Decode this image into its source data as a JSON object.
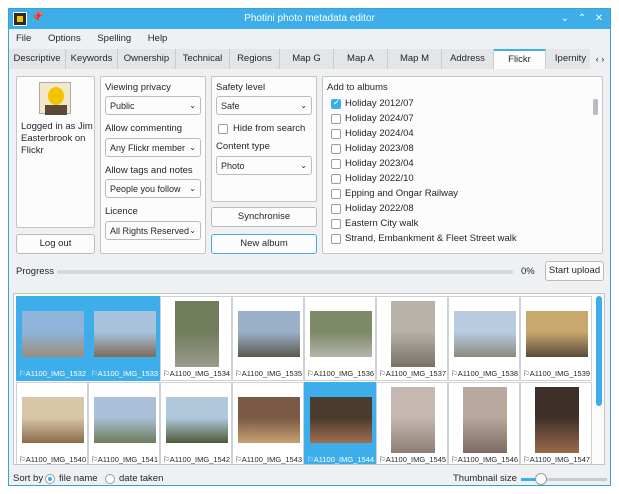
{
  "window": {
    "title": "Photini photo metadata editor"
  },
  "menu": [
    "File",
    "Options",
    "Spelling",
    "Help"
  ],
  "tabs": [
    "Descriptive",
    "Keywords",
    "Ownership",
    "Technical",
    "Regions",
    "Map G",
    "Map A",
    "Map M",
    "Address",
    "Flickr",
    "Ipernity"
  ],
  "active_tab": "Flickr",
  "user": {
    "logged_in_text": "Logged in as Jim Easterbrook on Flickr",
    "logout_label": "Log out"
  },
  "privacy": {
    "viewing_label": "Viewing privacy",
    "viewing_value": "Public",
    "commenting_label": "Allow commenting",
    "commenting_value": "Any Flickr member",
    "tags_label": "Allow tags and notes",
    "tags_value": "People you follow",
    "licence_label": "Licence",
    "licence_value": "All Rights Reserved"
  },
  "safety": {
    "level_label": "Safety level",
    "level_value": "Safe",
    "hide_label": "Hide from search",
    "content_label": "Content type",
    "content_value": "Photo"
  },
  "actions": {
    "sync_label": "Synchronise",
    "new_album_label": "New album"
  },
  "albums": {
    "label": "Add to albums",
    "items": [
      {
        "name": "Holiday 2012/07",
        "checked": true
      },
      {
        "name": "Holiday 2024/07",
        "checked": false
      },
      {
        "name": "Holiday 2024/04",
        "checked": false
      },
      {
        "name": "Holiday 2023/08",
        "checked": false
      },
      {
        "name": "Holiday 2023/04",
        "checked": false
      },
      {
        "name": "Holiday 2022/10",
        "checked": false
      },
      {
        "name": "Epping and Ongar Railway",
        "checked": false
      },
      {
        "name": "Holiday 2022/08",
        "checked": false
      },
      {
        "name": "Eastern City walk",
        "checked": false
      },
      {
        "name": "Strand, Embankment & Fleet Street walk",
        "checked": false
      }
    ]
  },
  "progress": {
    "label": "Progress",
    "percent": "0%",
    "start_label": "Start upload"
  },
  "thumbnails": [
    {
      "name": "A1100_IMG_1532",
      "selected": true
    },
    {
      "name": "A1100_IMG_1533",
      "selected": true
    },
    {
      "name": "A1100_IMG_1534",
      "selected": false
    },
    {
      "name": "A1100_IMG_1535",
      "selected": false
    },
    {
      "name": "A1100_IMG_1536",
      "selected": false
    },
    {
      "name": "A1100_IMG_1537",
      "selected": false
    },
    {
      "name": "A1100_IMG_1538",
      "selected": false
    },
    {
      "name": "A1100_IMG_1539",
      "selected": false
    },
    {
      "name": "A1100_IMG_1540",
      "selected": false
    },
    {
      "name": "A1100_IMG_1541",
      "selected": false
    },
    {
      "name": "A1100_IMG_1542",
      "selected": false
    },
    {
      "name": "A1100_IMG_1543",
      "selected": false
    },
    {
      "name": "A1100_IMG_1544",
      "selected": true
    },
    {
      "name": "A1100_IMG_1545",
      "selected": false
    },
    {
      "name": "A1100_IMG_1546",
      "selected": false
    },
    {
      "name": "A1100_IMG_1547",
      "selected": false
    }
  ],
  "status": {
    "sort_label": "Sort by",
    "file_name_label": "file name",
    "date_taken_label": "date taken",
    "thumb_size_label": "Thumbnail size"
  },
  "colors": {
    "accent": "#3daee9"
  }
}
